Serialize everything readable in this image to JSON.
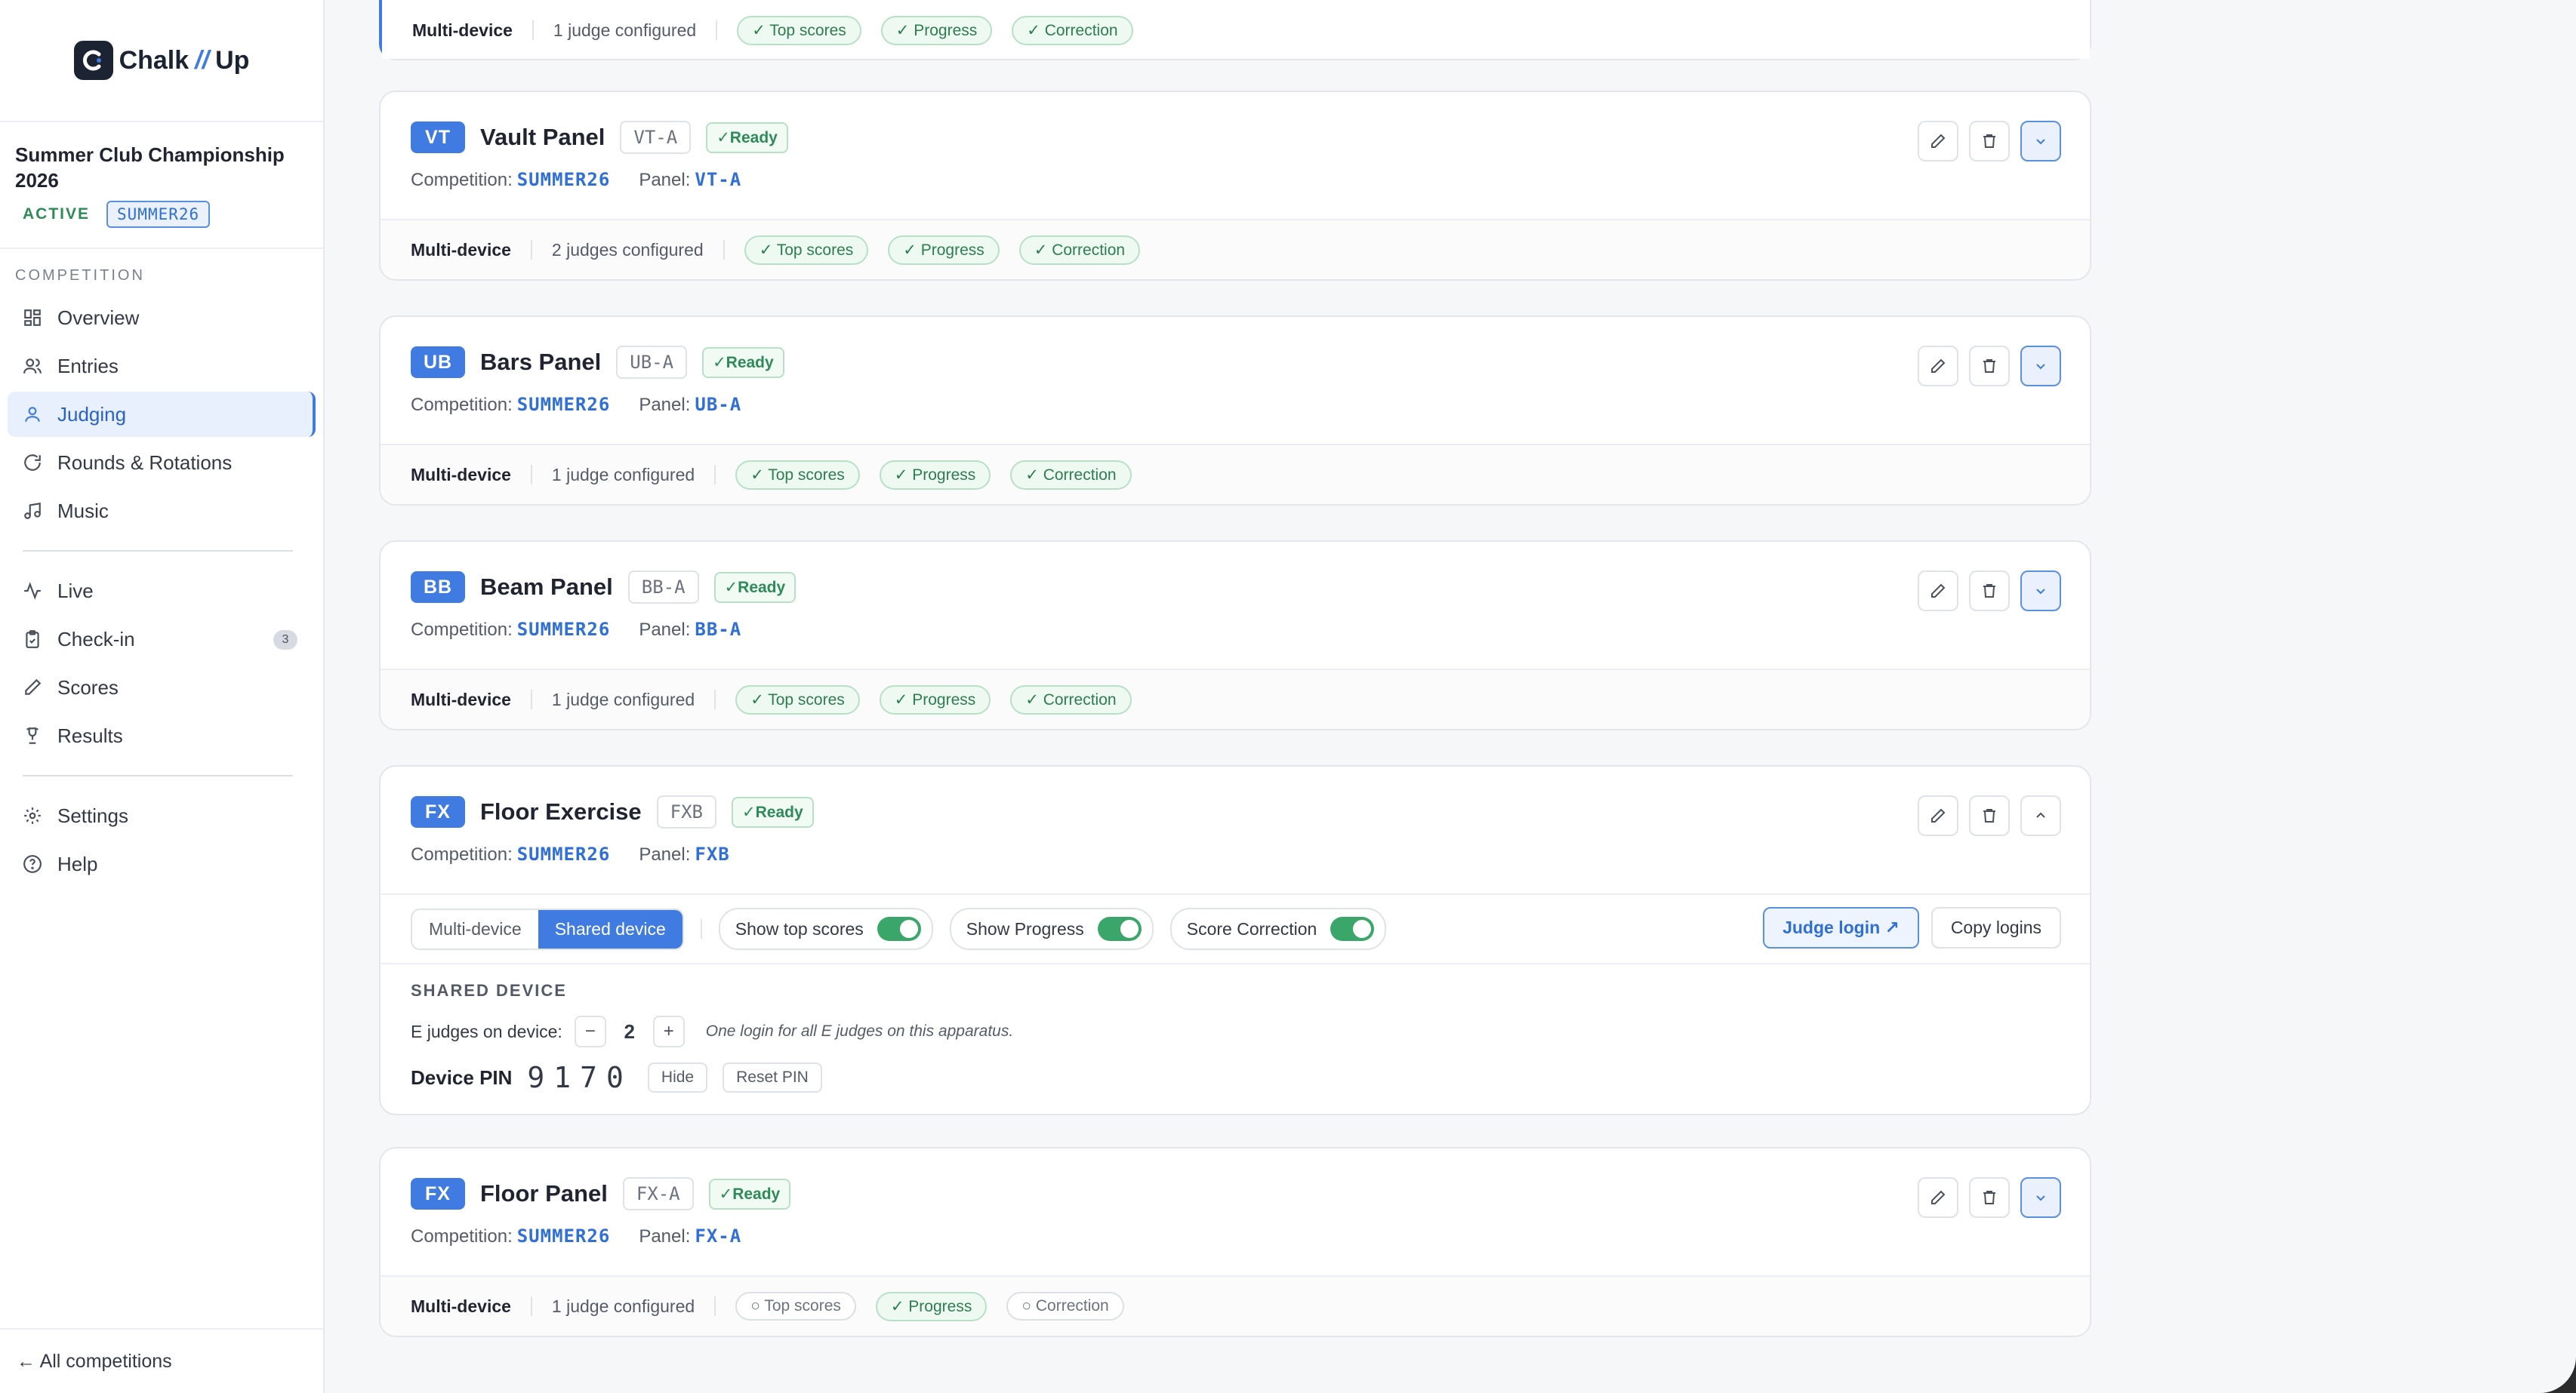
{
  "brand": {
    "name_left": "Chalk",
    "name_slash": "//",
    "name_right": "Up"
  },
  "competition": {
    "name": "Summer Club Championship 2026",
    "status": "ACTIVE",
    "code": "SUMMER26"
  },
  "nav": {
    "section_label": "COMPETITION",
    "group1": [
      {
        "label": "Overview",
        "icon": "grid-icon"
      },
      {
        "label": "Entries",
        "icon": "users-icon"
      },
      {
        "label": "Judging",
        "icon": "user-icon",
        "active": true
      },
      {
        "label": "Rounds & Rotations",
        "icon": "rotate-icon"
      },
      {
        "label": "Music",
        "icon": "music-icon"
      }
    ],
    "group2": [
      {
        "label": "Live",
        "icon": "activity-icon"
      },
      {
        "label": "Check-in",
        "icon": "clipboard-icon",
        "badge": "3"
      },
      {
        "label": "Scores",
        "icon": "pencil-icon"
      },
      {
        "label": "Results",
        "icon": "trophy-icon"
      }
    ],
    "group3": [
      {
        "label": "Settings",
        "icon": "gear-icon"
      },
      {
        "label": "Help",
        "icon": "help-icon"
      }
    ],
    "footer": "← All competitions"
  },
  "labels": {
    "competition": "Competition:",
    "panel": "Panel:",
    "ready": "✓Ready",
    "multi_device": "Multi-device",
    "shared_device": "Shared device",
    "show_top_scores": "Show top scores",
    "show_progress": "Show Progress",
    "score_correction": "Score Correction",
    "judge_login": "Judge login ↗",
    "copy_logins": "Copy logins",
    "shared_section": "SHARED DEVICE",
    "e_judges": "E judges on device:",
    "minus": "−",
    "plus": "+",
    "one_login_note": "One login for all E judges on this apparatus.",
    "device_pin": "Device PIN",
    "hide": "Hide",
    "reset_pin": "Reset PIN"
  },
  "partial_card": {
    "mode": "Multi-device",
    "judges": "1 judge configured",
    "chips": [
      "✓ Top scores",
      "✓ Progress",
      "✓ Correction"
    ]
  },
  "panels": [
    {
      "badge": "VT",
      "name": "Vault Panel",
      "code": "VT-A",
      "competition": "SUMMER26",
      "panel": "VT-A",
      "mode": "Multi-device",
      "judges": "2 judges configured",
      "chips": [
        {
          "label": "✓ Top scores",
          "on": true
        },
        {
          "label": "✓ Progress",
          "on": true
        },
        {
          "label": "✓ Correction",
          "on": true
        }
      ]
    },
    {
      "badge": "UB",
      "name": "Bars Panel",
      "code": "UB-A",
      "competition": "SUMMER26",
      "panel": "UB-A",
      "mode": "Multi-device",
      "judges": "1 judge configured",
      "chips": [
        {
          "label": "✓ Top scores",
          "on": true
        },
        {
          "label": "✓ Progress",
          "on": true
        },
        {
          "label": "✓ Correction",
          "on": true
        }
      ]
    },
    {
      "badge": "BB",
      "name": "Beam Panel",
      "code": "BB-A",
      "competition": "SUMMER26",
      "panel": "BB-A",
      "mode": "Multi-device",
      "judges": "1 judge configured",
      "chips": [
        {
          "label": "✓ Top scores",
          "on": true
        },
        {
          "label": "✓ Progress",
          "on": true
        },
        {
          "label": "✓ Correction",
          "on": true
        }
      ]
    }
  ],
  "expanded": {
    "badge": "FX",
    "name": "Floor Exercise",
    "code": "FXB",
    "competition": "SUMMER26",
    "panel": "FXB",
    "e_judges": "2",
    "pin": "9170"
  },
  "last_panel": {
    "badge": "FX",
    "name": "Floor Panel",
    "code": "FX-A",
    "competition": "SUMMER26",
    "panel": "FX-A",
    "mode": "Multi-device",
    "judges": "1 judge configured",
    "chips": [
      {
        "label": "○ Top scores",
        "on": false
      },
      {
        "label": "✓ Progress",
        "on": true
      },
      {
        "label": "○ Correction",
        "on": false
      }
    ]
  }
}
